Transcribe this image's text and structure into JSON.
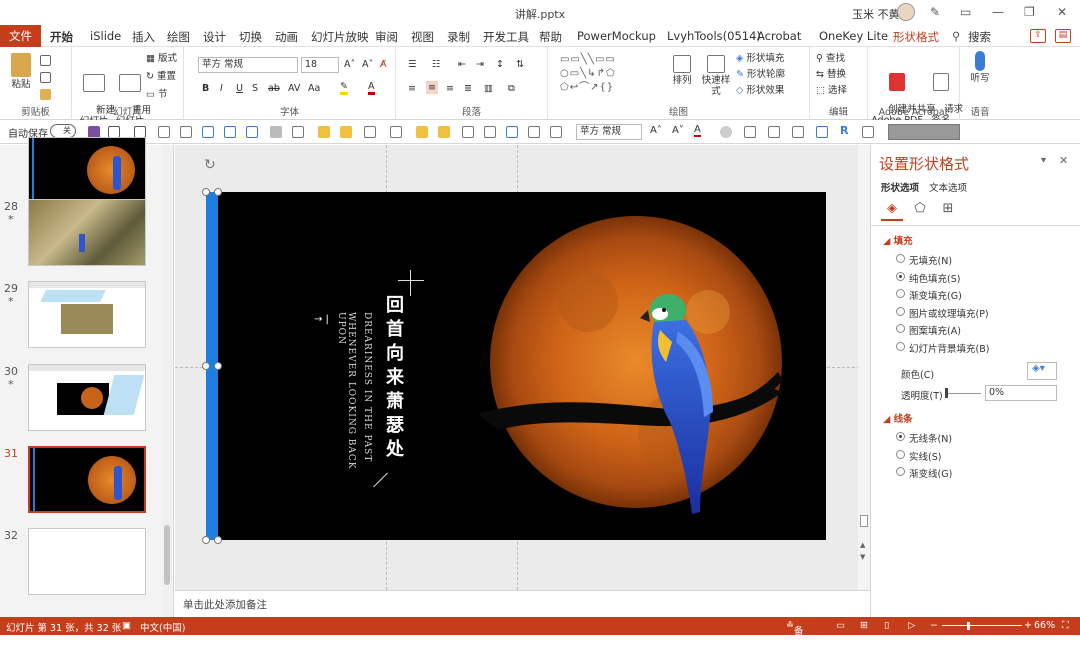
{
  "window": {
    "title": "讲解.pptx",
    "user": "玉米 不黄"
  },
  "tabs": {
    "file": "文件",
    "items": [
      "开始",
      "iSlide",
      "插入",
      "绘图",
      "设计",
      "切换",
      "动画",
      "幻灯片放映",
      "审阅",
      "视图",
      "录制",
      "开发工具",
      "帮助",
      "PowerMockup",
      "LvyhTools(0514)",
      "Acrobat",
      "OneKey Lite",
      "形状格式"
    ],
    "active": "开始",
    "search": "搜索"
  },
  "ribbon": {
    "clipboard": {
      "label": "剪贴板",
      "paste": "粘贴"
    },
    "slides": {
      "label": "幻灯片",
      "new_slide": "新建\n幻灯片",
      "reuse": "重用\n幻灯片",
      "layout": "版式",
      "reset": "重置",
      "section": "节"
    },
    "font": {
      "label": "字体",
      "font_name": "苹方 常规",
      "font_size": "18"
    },
    "paragraph": {
      "label": "段落"
    },
    "drawing": {
      "label": "绘图",
      "arrange": "排列",
      "quick_styles": "快速样式",
      "fill": "形状填充",
      "outline": "形状轮廓",
      "effects": "形状效果"
    },
    "editing": {
      "label": "编辑",
      "find": "查找",
      "replace": "替换",
      "select": "选择"
    },
    "adobe": {
      "label": "Adobe Acrobat",
      "create_share": "创建并共享\nAdobe PDF",
      "request_sign": "请求\n签名"
    },
    "voice": {
      "label": "语音",
      "dictate": "听写"
    }
  },
  "qat": {
    "autosave_label": "自动保存",
    "autosave_state": "关",
    "font_name": "苹方 常规"
  },
  "thumbnails": [
    {
      "num": "",
      "kind": "moon",
      "star": false
    },
    {
      "num": "28",
      "kind": "tree",
      "star": true
    },
    {
      "num": "29",
      "kind": "screen",
      "star": true
    },
    {
      "num": "30",
      "kind": "screen2",
      "star": true
    },
    {
      "num": "31",
      "kind": "moon",
      "star": false,
      "selected": true
    },
    {
      "num": "32",
      "kind": "blank",
      "star": false
    }
  ],
  "slide": {
    "title_cn": "回首向来萧瑟处",
    "subtitle_en_1": "WHENEVER LOOKING BACK UPON",
    "subtitle_en_2": "DREARINESS IN THE PAST",
    "arrow": "→ |"
  },
  "notes": {
    "placeholder": "单击此处添加备注"
  },
  "format_pane": {
    "title": "设置形状格式",
    "tab_shape": "形状选项",
    "tab_text": "文本选项",
    "fill_section": "填充",
    "fill_options": [
      {
        "label": "无填充(N)",
        "checked": false
      },
      {
        "label": "纯色填充(S)",
        "checked": true
      },
      {
        "label": "渐变填充(G)",
        "checked": false
      },
      {
        "label": "图片或纹理填充(P)",
        "checked": false
      },
      {
        "label": "图案填充(A)",
        "checked": false
      },
      {
        "label": "幻灯片背景填充(B)",
        "checked": false
      }
    ],
    "color_label": "颜色(C)",
    "transparency_label": "透明度(T)",
    "transparency_value": "0%",
    "line_section": "线条",
    "line_options": [
      {
        "label": "无线条(N)",
        "checked": true
      },
      {
        "label": "实线(S)",
        "checked": false
      },
      {
        "label": "渐变线(G)",
        "checked": false
      }
    ]
  },
  "status": {
    "slide_info": "幻灯片 第 31 张，共 32 张",
    "language": "中文(中国)",
    "notes": "备注",
    "zoom": "66%"
  },
  "colors": {
    "accent": "#c43e1c",
    "blue_bar": "#1e7ee0"
  }
}
